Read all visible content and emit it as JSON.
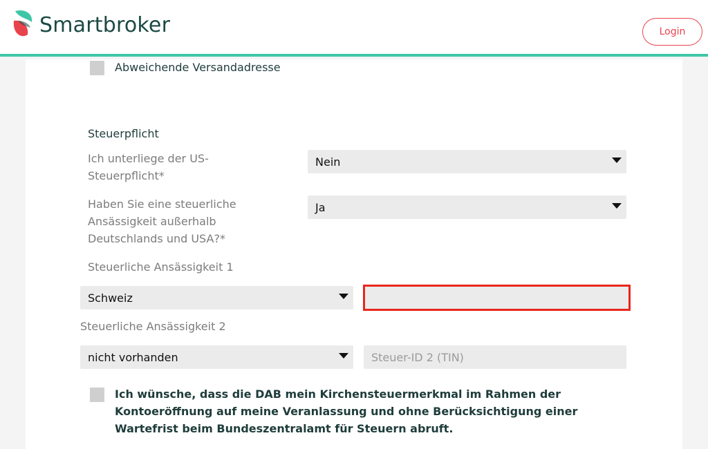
{
  "header": {
    "brand": "Smartbroker",
    "login_label": "Login",
    "accent_color": "#3fc6a6",
    "login_color": "#e8434d"
  },
  "form": {
    "alt_address_label": "Abweichende Versandadresse",
    "tax_section_title": "Steuerpflicht",
    "us_tax": {
      "label_line1": "Ich unterliege der US-",
      "label_line2": "Steuerpflicht*",
      "value": "Nein"
    },
    "foreign_residency": {
      "label_line1": "Haben Sie eine steuerliche",
      "label_line2": "Ansässigkeit außerhalb",
      "label_line3": "Deutschlands und USA?*",
      "value": "Ja"
    },
    "residency1": {
      "label": "Steuerliche Ansässigkeit 1",
      "country": "Schweiz",
      "tin_value": ""
    },
    "residency2": {
      "label": "Steuerliche Ansässigkeit 2",
      "country": "nicht vorhanden",
      "tin_placeholder": "Steuer-ID 2 (TIN)"
    },
    "church_tax": {
      "line1": "Ich wünsche, dass die DAB mein Kirchensteuermerkmal im Rahmen der",
      "line2": "Kontoeröffnung auf meine Veranlassung und ohne Berücksichtigung einer",
      "line3": "Wartefrist beim Bundeszentralamt für Steuern abruft."
    }
  }
}
